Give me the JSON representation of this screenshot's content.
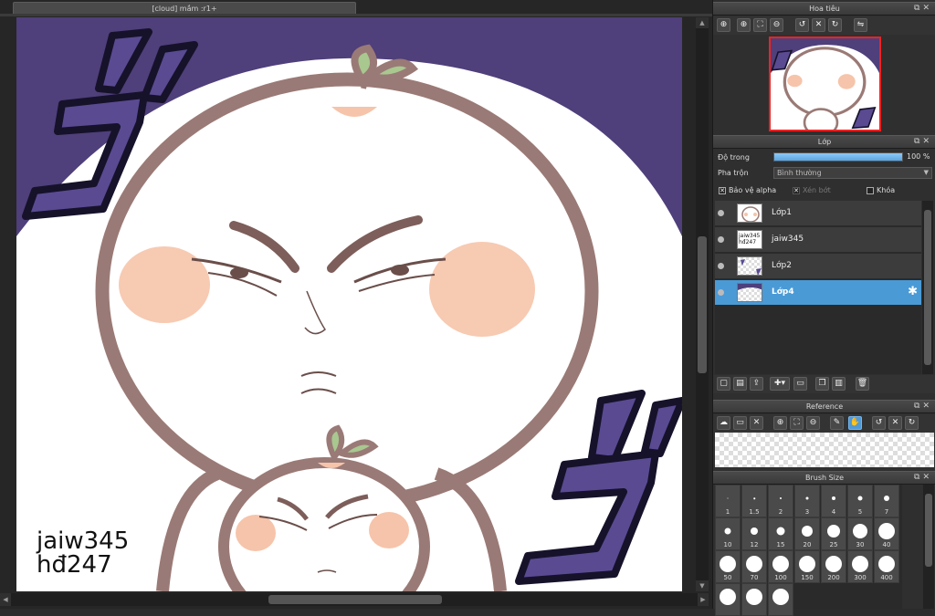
{
  "document": {
    "tab_title": "[cloud] mắm :r1+"
  },
  "artwork": {
    "watermark_line1": "jaiw345",
    "watermark_line2": "hđ247",
    "colors": {
      "sky": "#4f3f7a",
      "outline": "#9a7a76",
      "blush": "#f6c4aa",
      "sprout": "#a8c890",
      "jo_fill": "#5a4a92",
      "jo_stroke": "#16122a"
    }
  },
  "navigator": {
    "title": "Hoa tiêu",
    "tools": [
      "zoom-in-icon",
      "zoom-in-alt-icon",
      "fit-icon",
      "zoom-out-icon",
      "rotate-left-icon",
      "reset-icon",
      "rotate-right-icon",
      "flip-icon"
    ]
  },
  "layers": {
    "title": "Lớp",
    "opacity_label": "Độ trong",
    "opacity_value": "100 %",
    "opacity_level": 100,
    "blend_label": "Pha trộn",
    "blend_value": "Bình thường",
    "protect_alpha_label": "Bảo vệ alpha",
    "protect_alpha_checked": "✕",
    "clipping_label": "Xén bớt",
    "clipping_checked": "✕",
    "lock_label": "Khóa",
    "lock_checked": "",
    "items": [
      {
        "name": "Lớp1"
      },
      {
        "name": "jaiw345",
        "thumb_text": "jaiw345 hđ247"
      },
      {
        "name": "Lớp2"
      },
      {
        "name": "Lớp4"
      }
    ],
    "selected": "Lớp4"
  },
  "reference": {
    "title": "Reference"
  },
  "brush_size": {
    "title": "Brush Size",
    "sizes": [
      "1",
      "1.5",
      "2",
      "3",
      "4",
      "5",
      "7",
      "10",
      "12",
      "15",
      "20",
      "25",
      "30",
      "40",
      "50",
      "70",
      "100",
      "150",
      "200",
      "300",
      "400",
      "",
      "",
      ""
    ]
  }
}
